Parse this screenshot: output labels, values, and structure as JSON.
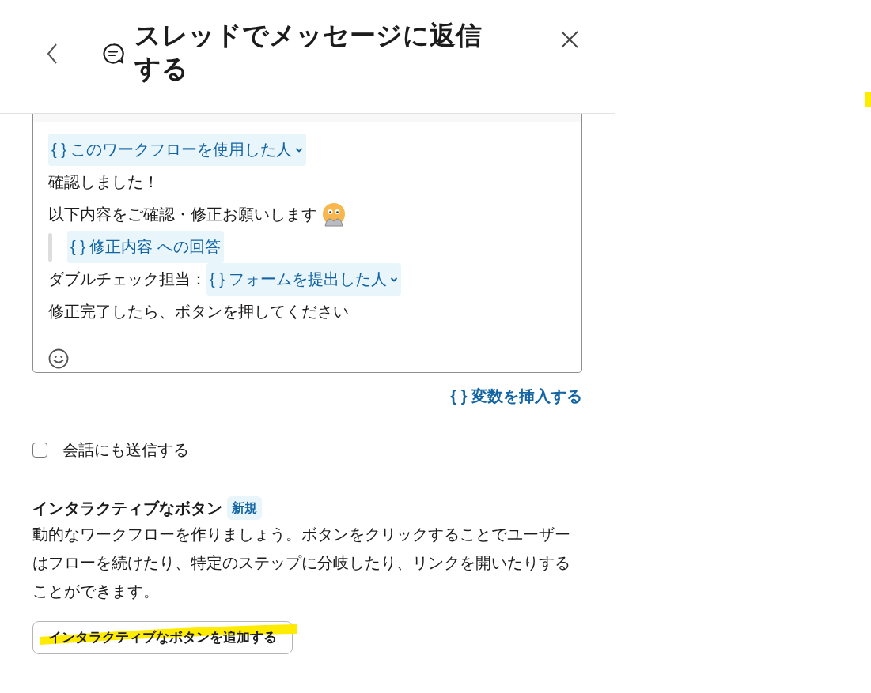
{
  "header": {
    "title": "スレッドでメッセージに返信する"
  },
  "message": {
    "lines": [
      {
        "quote": false,
        "segments": [
          {
            "kind": "variable",
            "label": "{ } このワークフローを使用した人",
            "dropdown": true
          }
        ]
      },
      {
        "quote": false,
        "segments": [
          {
            "kind": "text",
            "text": "確認しました！"
          }
        ]
      },
      {
        "quote": false,
        "segments": [
          {
            "kind": "text",
            "text": "以下内容をご確認・修正お願いします"
          },
          {
            "kind": "emoji"
          }
        ]
      },
      {
        "quote": true,
        "segments": [
          {
            "kind": "variable",
            "label": "{ } 修正内容 への回答",
            "dropdown": false
          }
        ]
      },
      {
        "quote": false,
        "segments": [
          {
            "kind": "text",
            "text": "ダブルチェック担当："
          },
          {
            "kind": "variable",
            "label": "{ } フォームを提出した人",
            "dropdown": true
          }
        ]
      },
      {
        "quote": false,
        "segments": [
          {
            "kind": "text",
            "text": "修正完了したら、ボタンを押してください"
          }
        ]
      }
    ]
  },
  "insert_variable": "{ } 変数を挿入する",
  "send_to_channel": {
    "label": "会話にも送信する",
    "checked": false
  },
  "interactive_buttons": {
    "title": "インタラクティブなボタン",
    "badge": "新規",
    "description": "動的なワークフローを作りましょう。ボタンをクリックすることでユーザーはフローを続けたり、特定のステップに分岐したり、リンクを開いたりすることができます。",
    "button": "インタラクティブなボタンを追加する"
  }
}
